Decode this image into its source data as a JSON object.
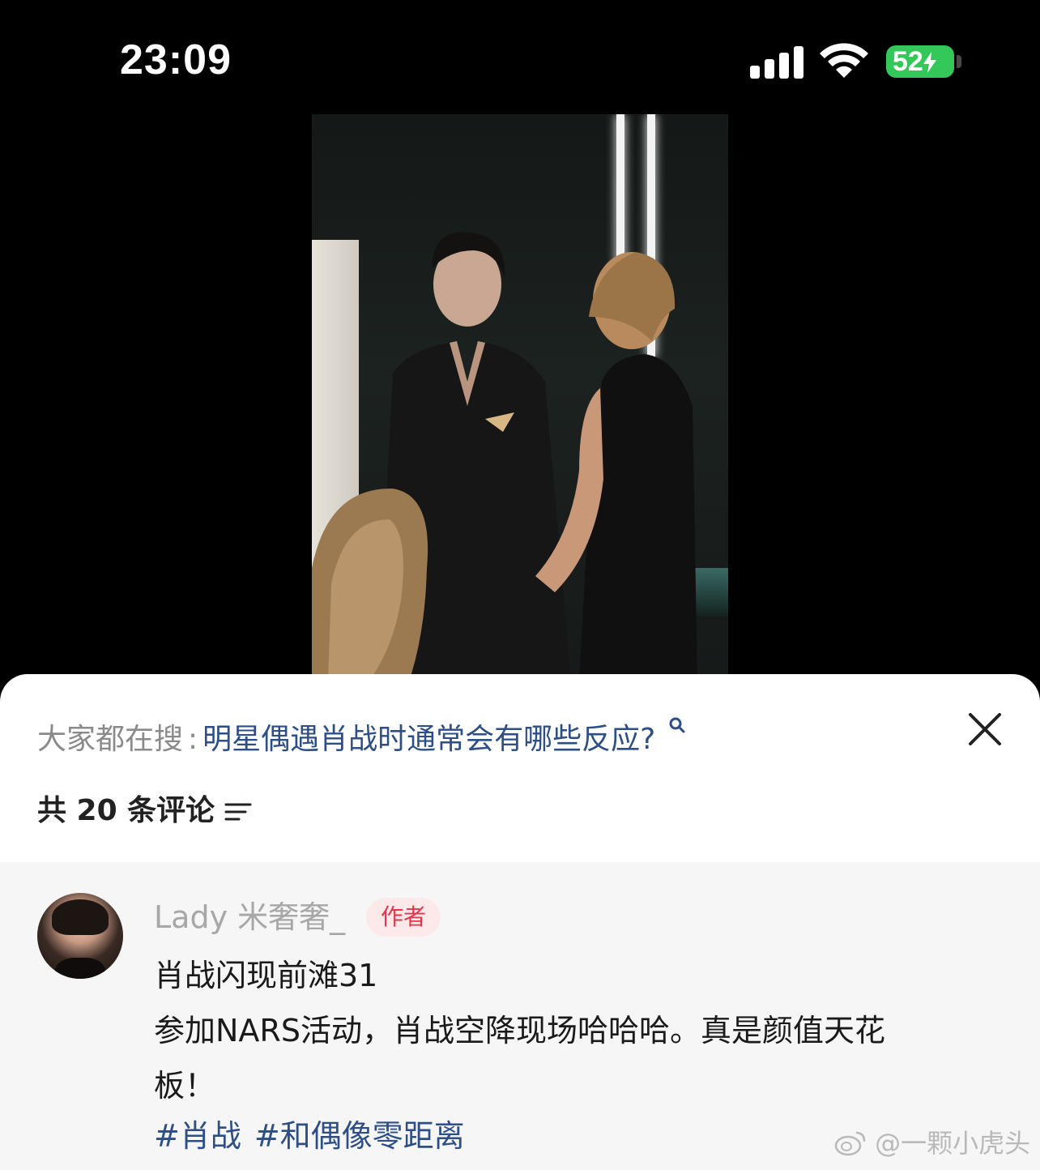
{
  "status_bar": {
    "time": "23:09",
    "battery_level": "52",
    "battery_charging": true,
    "signal_bars": 4,
    "wifi": true
  },
  "video": {
    "accent_color": "#1c2220"
  },
  "sheet": {
    "search_prefix": "大家都在搜",
    "search_separator": ":",
    "search_topic": "明星偶遇肖战时通常会有哪些反应?",
    "comment_count_label": "共 20 条评论"
  },
  "comment": {
    "author_name": "Lady 米奢奢_",
    "author_badge": "作者",
    "lines": [
      "肖战闪现前滩31",
      "参加NARS活动，肖战空降现场哈哈哈。真是颜值天花",
      "板！"
    ],
    "hashtags": [
      "#肖战",
      "#和偶像零距离"
    ]
  },
  "watermark": "@一颗小虎头",
  "colors": {
    "link": "#2d4e86",
    "badge_bg": "#fde8ea",
    "badge_text": "#e8344b",
    "battery": "#34c759"
  }
}
